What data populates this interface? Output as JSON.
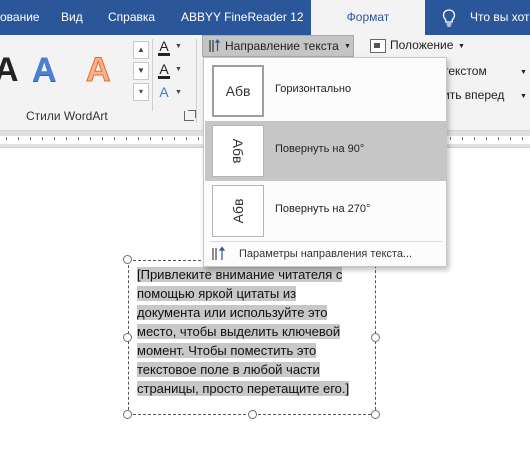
{
  "tabs": [
    {
      "label": "ование"
    },
    {
      "label": "Вид"
    },
    {
      "label": "Справка"
    },
    {
      "label": "ABBYY FineReader 12"
    },
    {
      "label": "Формат"
    }
  ],
  "tell_me": {
    "label": "Что вы хот"
  },
  "colors": {
    "tab_bar": "#2b579a",
    "ribbon": "#f3f3f3",
    "highlight": "#c6c6c6"
  },
  "wordart": {
    "letter": "A",
    "group_label": "Стили WordArt"
  },
  "ribbon": {
    "text_direction_label": "Направление текста",
    "position_label": "Положение",
    "wrap_text_label": "текстом",
    "bring_forward_label": "ить вперед"
  },
  "menu": {
    "items": [
      {
        "label": "Горизонтально",
        "preview": "Абв",
        "rotation": 0,
        "highlighted": false
      },
      {
        "label": "Повернуть на 90°",
        "preview": "Абв",
        "rotation": 90,
        "highlighted": true
      },
      {
        "label": "Повернуть на 270°",
        "preview": "Абв",
        "rotation": 270,
        "highlighted": false
      }
    ],
    "footer_label": "Параметры направления текста..."
  },
  "textbox": {
    "lines": [
      "[Привлеките внимание читателя с",
      "помощью яркой цитаты из",
      "документа или используйте это",
      "место, чтобы выделить ключевой",
      "момент. Чтобы поместить это",
      "текстовое поле в любой части",
      "страницы, просто перетащите его.]"
    ]
  }
}
